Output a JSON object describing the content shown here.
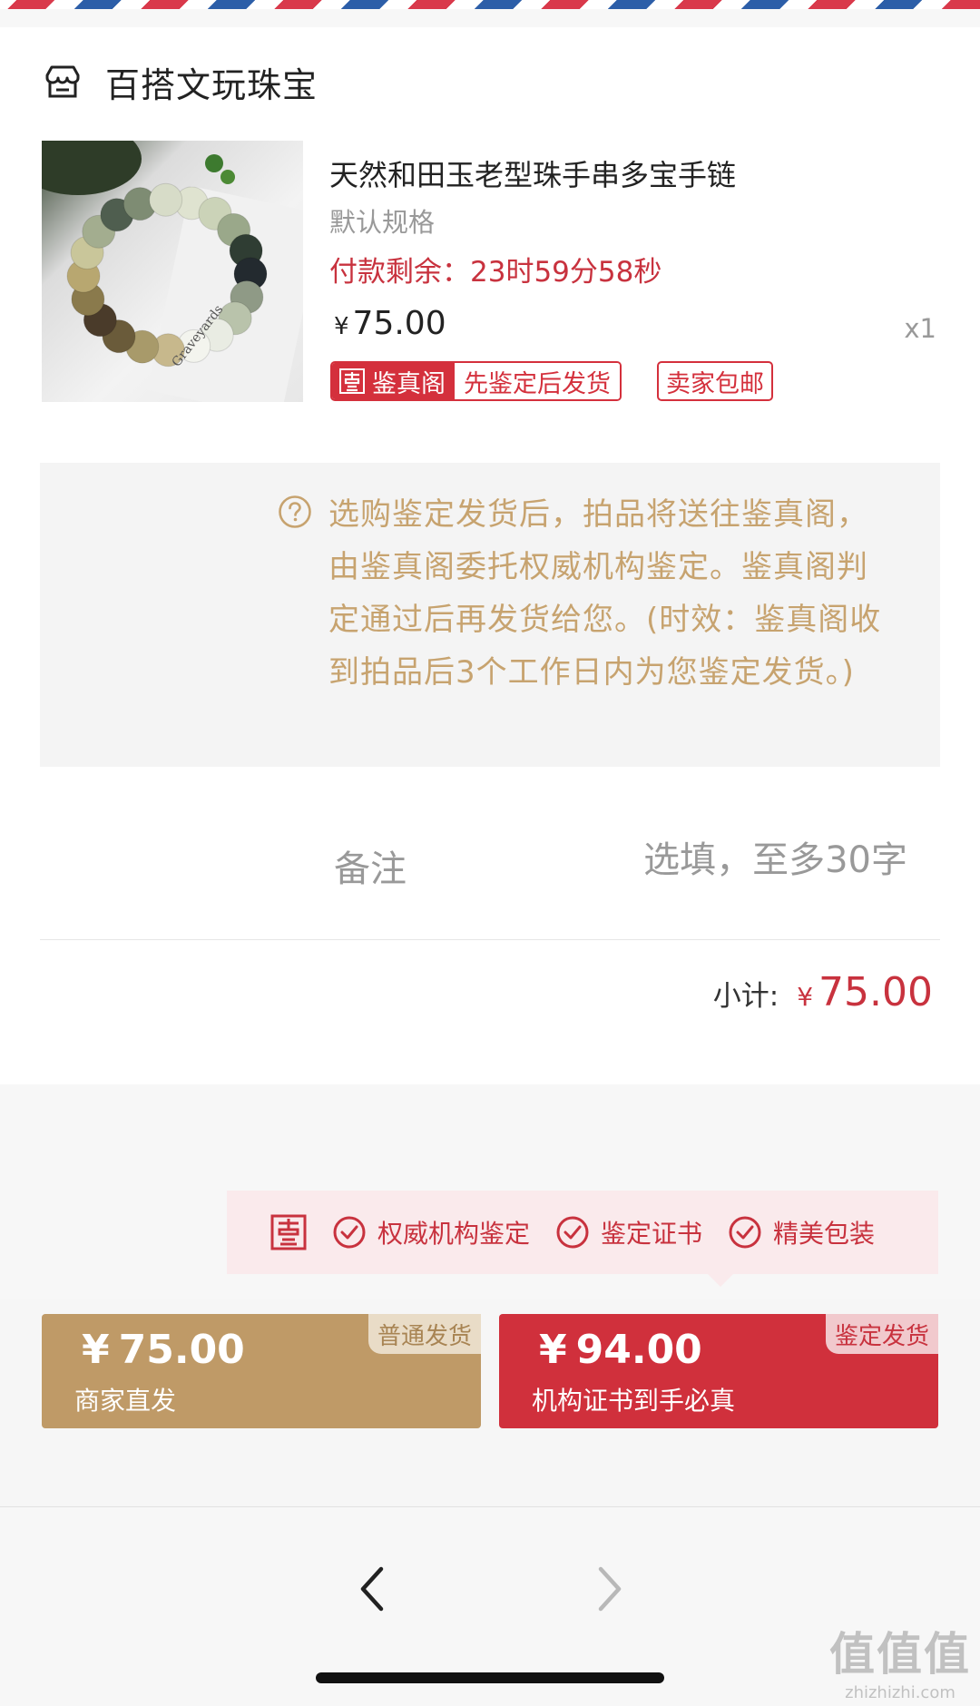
{
  "shop": {
    "name": "百搭文玩珠宝",
    "icon": "store-icon"
  },
  "product": {
    "title": "天然和田玉老型珠手串多宝手链",
    "spec": "默认规格",
    "payment_remaining": "付款剩余：23时59分58秒",
    "currency": "¥",
    "price": "75.00",
    "quantity": "x1",
    "badge_brand": "鉴真阁",
    "badge_policy": "先鉴定后发货",
    "badge_shipping": "卖家包邮"
  },
  "notice": {
    "icon": "question-circle-icon",
    "text": "选购鉴定发货后，拍品将送往鉴真阁，由鉴真阁委托权威机构鉴定。鉴真阁判定通过后再发货给您。(时效：鉴真阁收到拍品后3个工作日内为您鉴定发货。)"
  },
  "remark": {
    "label": "备注",
    "placeholder": "选填，至多30字"
  },
  "subtotal": {
    "label": "小计:",
    "currency": "¥",
    "value": "75.00"
  },
  "tips": {
    "items": [
      "权威机构鉴定",
      "鉴定证书",
      "精美包装"
    ]
  },
  "shipping_options": [
    {
      "tag": "普通发货",
      "currency": "¥",
      "price": "75.00",
      "subtitle": "商家直发"
    },
    {
      "tag": "鉴定发货",
      "currency": "¥",
      "price": "94.00",
      "subtitle": "机构证书到手必真"
    }
  ],
  "watermark": {
    "big": "值值值",
    "small": "zhizhizhi.com"
  },
  "colors": {
    "accent_red": "#d0303c",
    "gold": "#bf9a67",
    "notice_text": "#c7a36f"
  }
}
